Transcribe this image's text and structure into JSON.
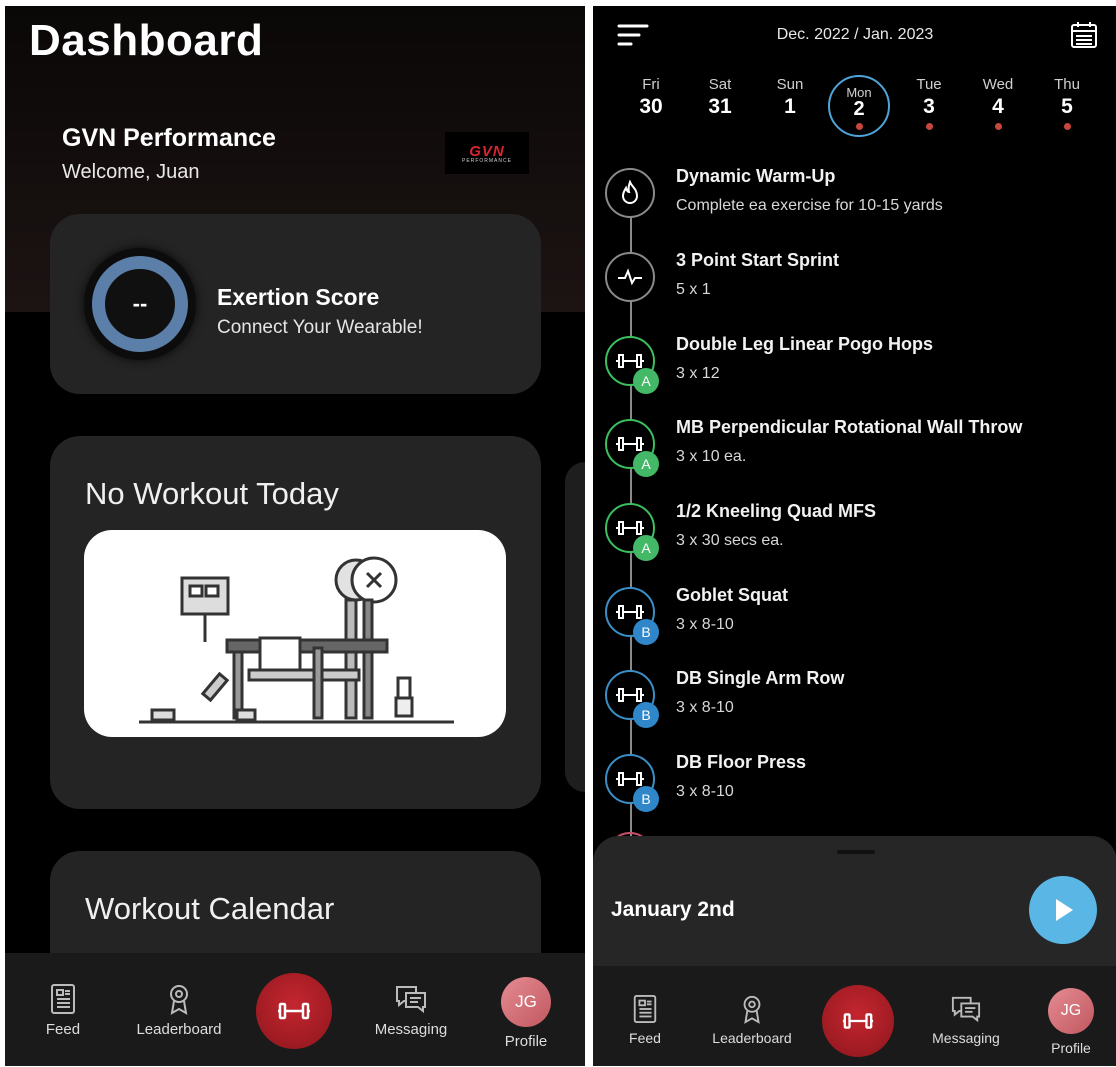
{
  "dashboard": {
    "title": "Dashboard",
    "org_name": "GVN Performance",
    "welcome": "Welcome, Juan",
    "logo_text": "GVN",
    "logo_sub": "PERFORMANCE",
    "exertion": {
      "value": "--",
      "title": "Exertion Score",
      "subtitle": "Connect Your Wearable!"
    },
    "no_workout_title": "No Workout Today",
    "calendar_title": "Workout Calendar"
  },
  "nav": {
    "feed": "Feed",
    "leaderboard": "Leaderboard",
    "messaging": "Messaging",
    "profile": "Profile",
    "avatar_initials": "JG"
  },
  "schedule": {
    "month_label": "Dec. 2022 / Jan. 2023",
    "days": [
      {
        "name": "Fri",
        "date": "30",
        "dot": false
      },
      {
        "name": "Sat",
        "date": "31",
        "dot": false
      },
      {
        "name": "Sun",
        "date": "1",
        "dot": false
      },
      {
        "name": "Mon",
        "date": "2",
        "dot": true,
        "selected": true
      },
      {
        "name": "Tue",
        "date": "3",
        "dot": true
      },
      {
        "name": "Wed",
        "date": "4",
        "dot": true
      },
      {
        "name": "Thu",
        "date": "5",
        "dot": true
      }
    ],
    "exercises": [
      {
        "name": "Dynamic Warm-Up",
        "detail": "Complete ea exercise for 10-15 yards",
        "icon": "flame-icon",
        "group": ""
      },
      {
        "name": "3 Point Start Sprint",
        "detail": "5 x 1",
        "icon": "pulse-icon",
        "group": ""
      },
      {
        "name": "Double Leg Linear Pogo Hops",
        "detail": "3 x 12",
        "icon": "dumbbell-icon",
        "group": "A"
      },
      {
        "name": "MB Perpendicular Rotational Wall Throw",
        "detail": "3 x 10 ea.",
        "icon": "dumbbell-icon",
        "group": "A"
      },
      {
        "name": "1/2 Kneeling Quad MFS",
        "detail": "3 x 30 secs ea.",
        "icon": "dumbbell-icon",
        "group": "A"
      },
      {
        "name": "Goblet Squat",
        "detail": "3 x 8-10",
        "icon": "dumbbell-icon",
        "group": "B"
      },
      {
        "name": "DB Single Arm Row",
        "detail": "3 x 8-10",
        "icon": "dumbbell-icon",
        "group": "B"
      },
      {
        "name": "DB Floor Press",
        "detail": "3 x 8-10",
        "icon": "dumbbell-icon",
        "group": "B"
      }
    ],
    "sheet_date": "January 2nd"
  },
  "colors": {
    "accent_red": "#b51f28",
    "ring_blue": "#5b7fa8",
    "group_a": "#43b866",
    "group_b": "#2f86c8",
    "play_blue": "#5ab6e4"
  }
}
